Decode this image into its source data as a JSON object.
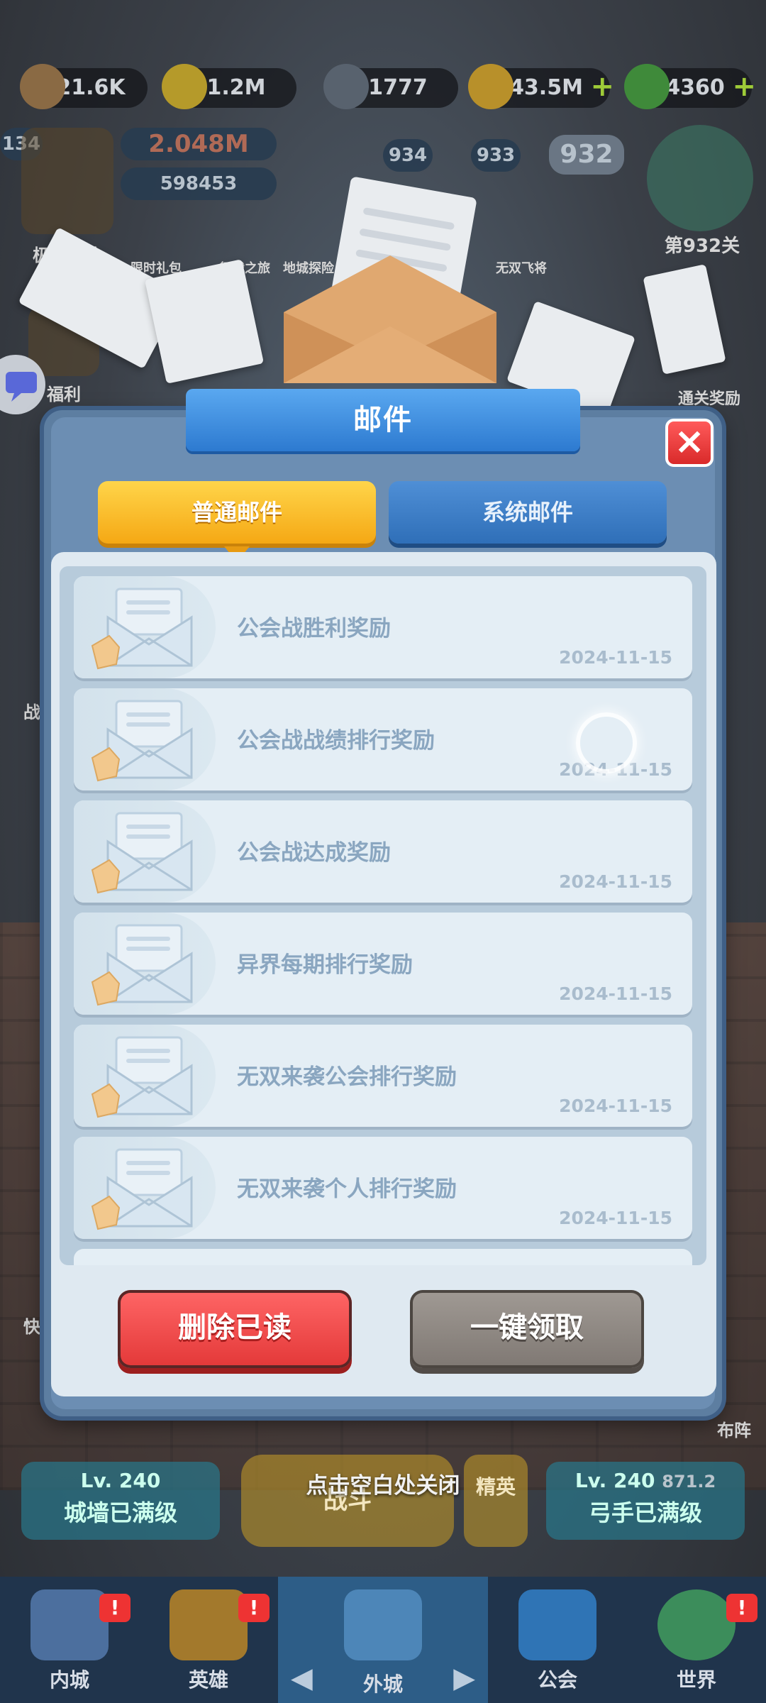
{
  "resources": [
    {
      "name": "wood",
      "value": "21.6K"
    },
    {
      "name": "gold-coin-star",
      "value": "1.2M"
    },
    {
      "name": "iron",
      "value": "1777"
    },
    {
      "name": "gold",
      "value": "43.5M",
      "has_plus": true
    },
    {
      "name": "gem",
      "value": "4360",
      "has_plus": true
    }
  ],
  "player": {
    "level": "134",
    "power": "2.048M",
    "id": "598453"
  },
  "stage": {
    "prev2": "934",
    "prev1": "933",
    "current": "932",
    "label": "第932关"
  },
  "side_labels": {
    "limit_boss": "极限考验",
    "welfare": "福利",
    "limited_gift": "限时礼包",
    "journey": "征战之旅",
    "dungeon": "地城探险",
    "hero": "无双飞将",
    "clear_reward": "通关奖励",
    "fast": "快",
    "formation": "布阵",
    "battle": "战"
  },
  "modal": {
    "title": "邮件",
    "close_icon": "×",
    "tabs": [
      {
        "label": "普通邮件",
        "active": true
      },
      {
        "label": "系统邮件",
        "active": false
      }
    ],
    "mails": [
      {
        "title": "公会战胜利奖励",
        "date": "2024-11-15"
      },
      {
        "title": "公会战战绩排行奖励",
        "date": "2024-11-15"
      },
      {
        "title": "公会战达成奖励",
        "date": "2024-11-15"
      },
      {
        "title": "异界每期排行奖励",
        "date": "2024-11-15"
      },
      {
        "title": "无双来袭公会排行奖励",
        "date": "2024-11-15"
      },
      {
        "title": "无双来袭个人排行奖励",
        "date": "2024-11-15"
      }
    ],
    "delete_read_label": "删除已读",
    "collect_all_label": "一键领取"
  },
  "hint": "点击空白处关闭",
  "status": {
    "wall_level": "Lv. 240",
    "wall_text": "城墙已满级",
    "battle_label": "战斗",
    "elite_label": "精英",
    "archer_level": "Lv. 240",
    "archer_extra": "871.2",
    "archer_text": "弓手已满级"
  },
  "bottom_nav": [
    {
      "label": "内城",
      "badge": "!"
    },
    {
      "label": "英雄",
      "badge": "!"
    },
    {
      "label": "外城",
      "badge": ""
    },
    {
      "label": "公会",
      "badge": ""
    },
    {
      "label": "世界",
      "badge": "!"
    }
  ],
  "colors": {
    "tab_active": "#f5a814",
    "tab_inactive": "#2f6fb8",
    "delete_button": "#e33838",
    "collect_button": "#7f7873",
    "mail_title": "#8aa6c0"
  }
}
